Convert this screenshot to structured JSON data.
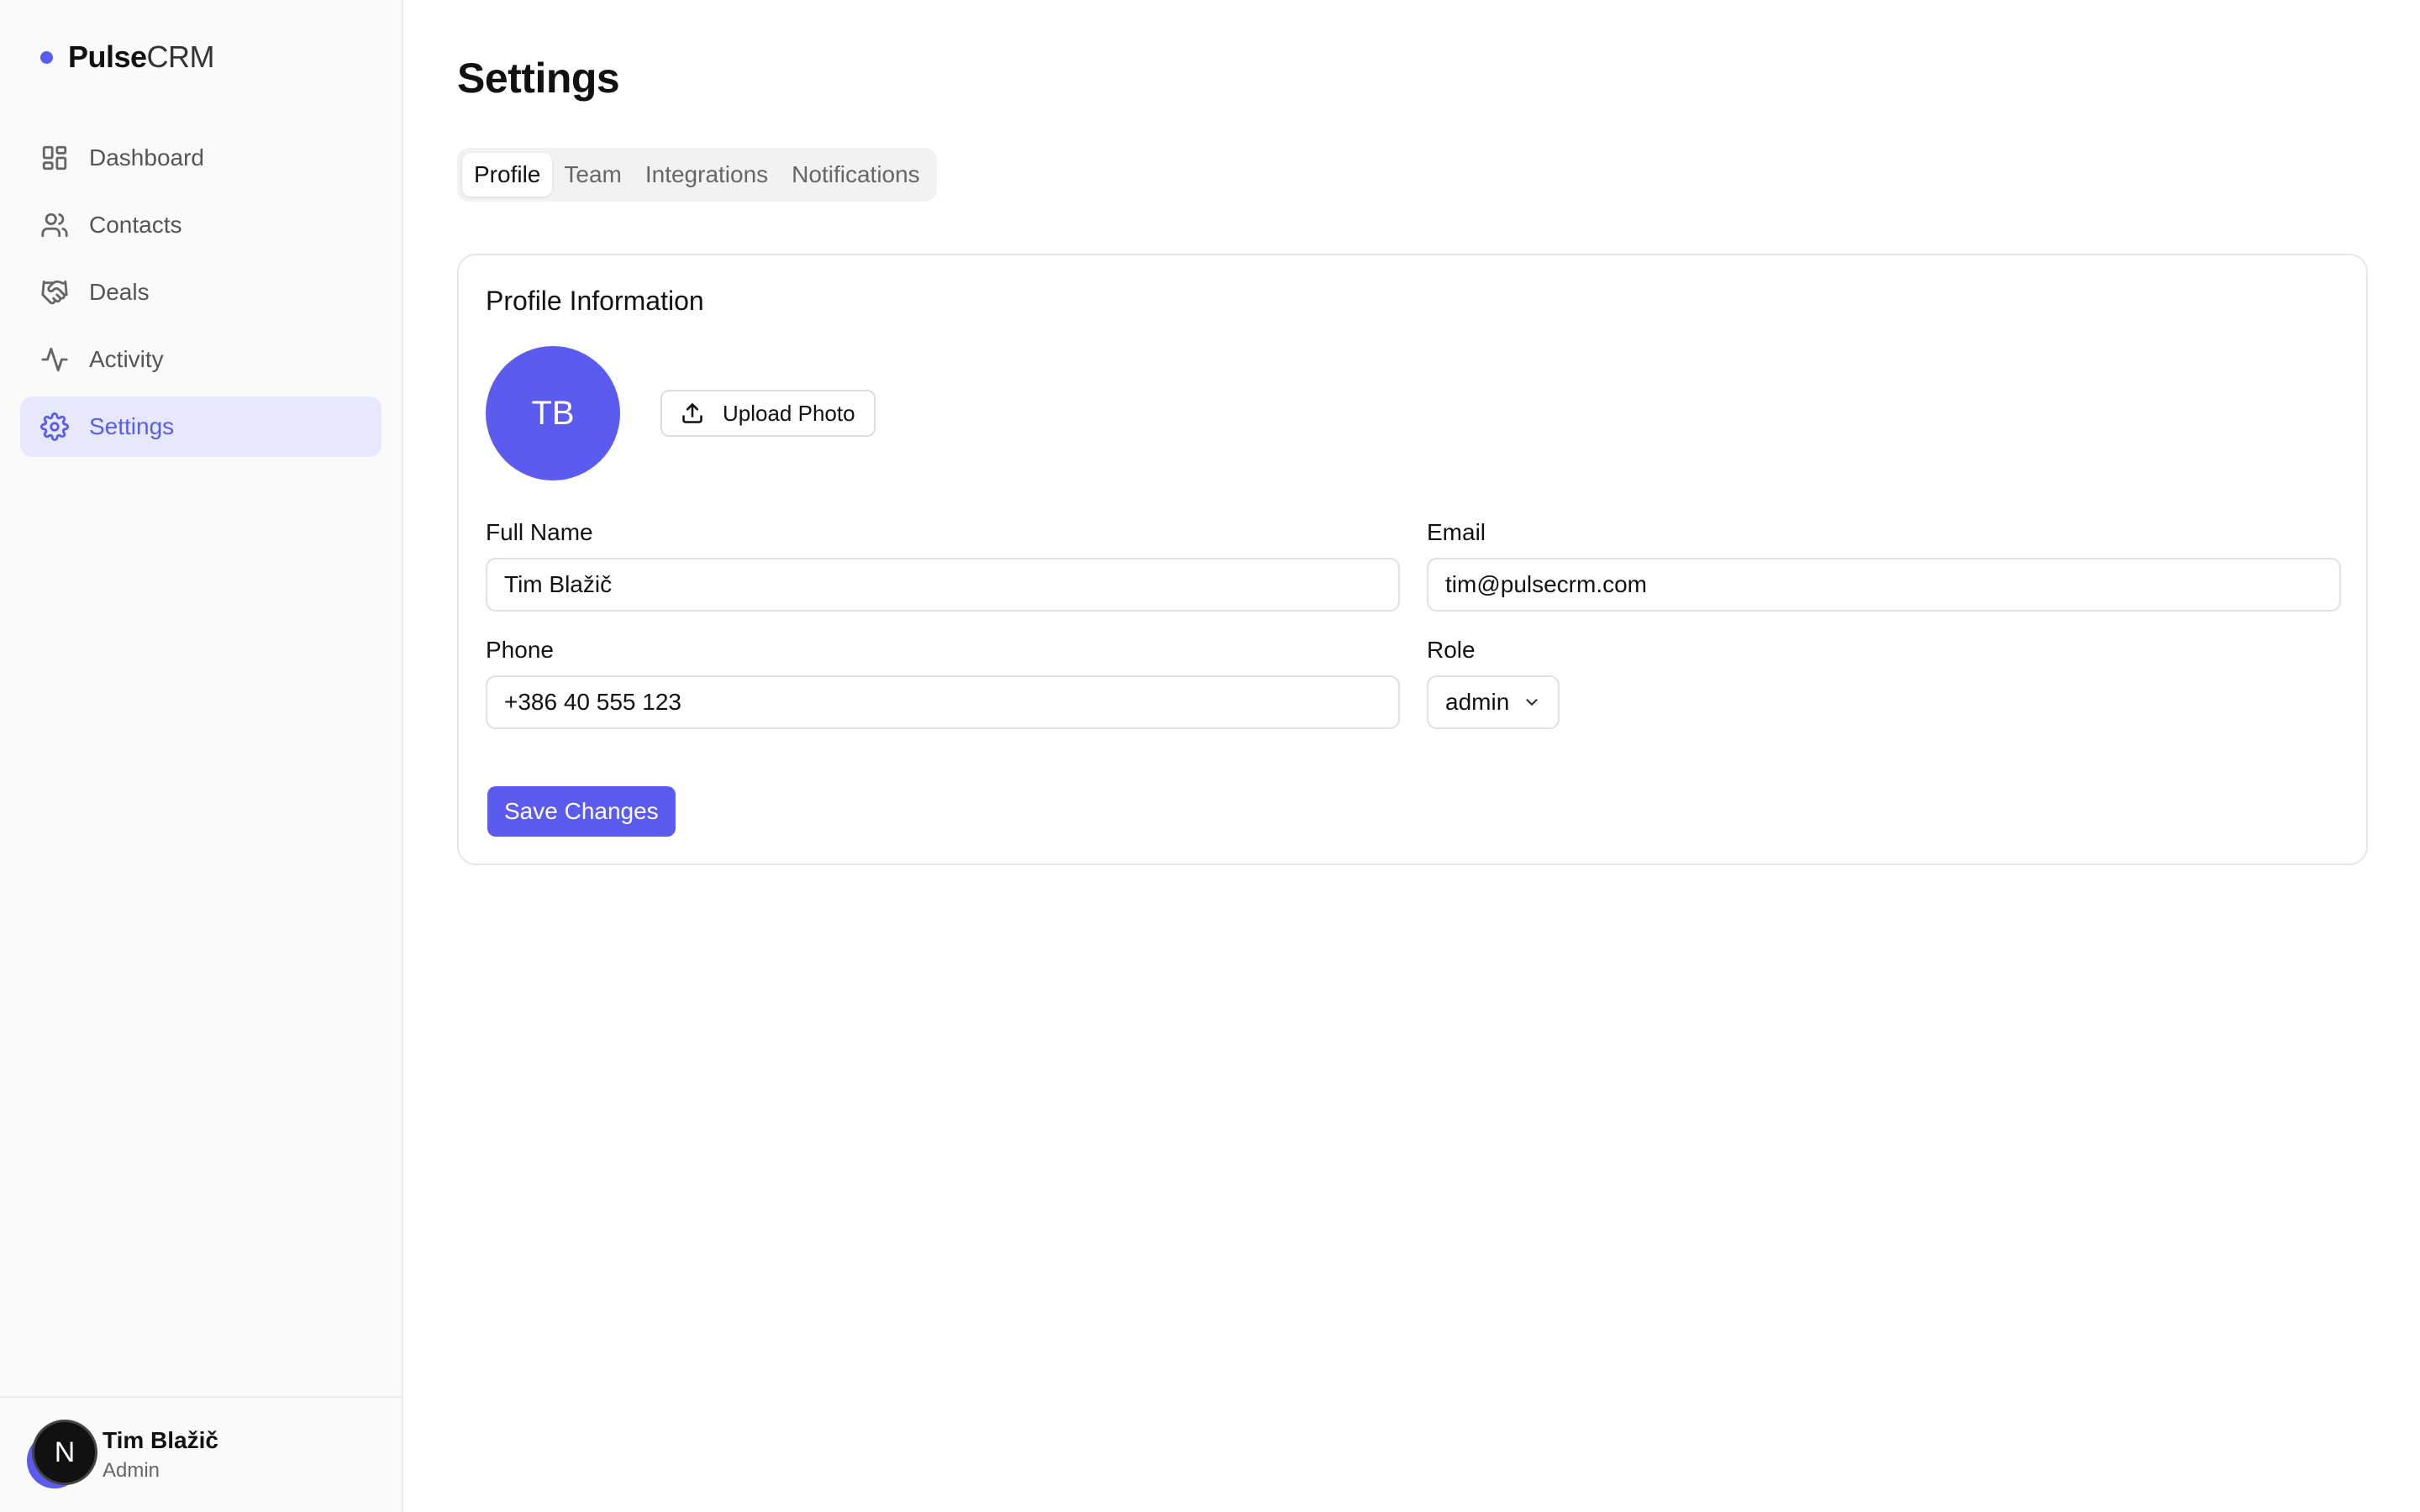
{
  "brand": {
    "name": "Pulse",
    "suffix": "CRM",
    "accent": "#5b5bf0"
  },
  "sidebar": {
    "items": [
      {
        "label": "Dashboard",
        "icon": "dashboard-icon"
      },
      {
        "label": "Contacts",
        "icon": "users-icon"
      },
      {
        "label": "Deals",
        "icon": "handshake-icon"
      },
      {
        "label": "Activity",
        "icon": "activity-icon"
      },
      {
        "label": "Settings",
        "icon": "gear-icon",
        "active": true
      }
    ]
  },
  "user": {
    "initial": "N",
    "name": "Tim Blažič",
    "role": "Admin"
  },
  "page": {
    "title": "Settings"
  },
  "tabs": [
    {
      "label": "Profile",
      "active": true
    },
    {
      "label": "Team"
    },
    {
      "label": "Integrations"
    },
    {
      "label": "Notifications"
    }
  ],
  "profile": {
    "section_title": "Profile Information",
    "avatar_initials": "TB",
    "upload_label": "Upload Photo",
    "full_name_label": "Full Name",
    "full_name_value": "Tim Blažič",
    "email_label": "Email",
    "email_value": "tim@pulsecrm.com",
    "phone_label": "Phone",
    "phone_value": "+386 40 555 123",
    "role_label": "Role",
    "role_value": "admin",
    "save_label": "Save Changes"
  }
}
